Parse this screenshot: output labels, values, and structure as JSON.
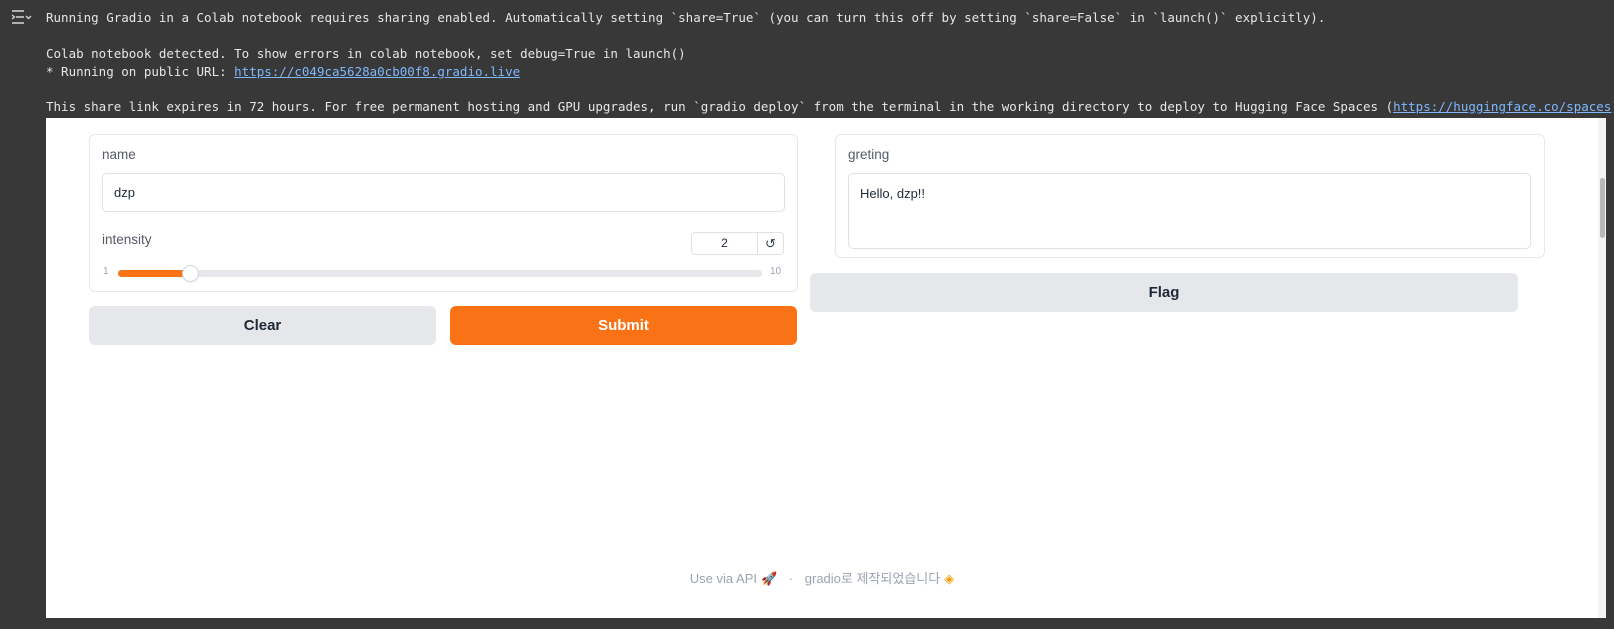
{
  "console": {
    "line1": "Running Gradio in a Colab notebook requires sharing enabled. Automatically setting `share=True` (you can turn this off by setting `share=False` in `launch()` explicitly).",
    "line2": "Colab notebook detected. To show errors in colab notebook, set debug=True in launch()",
    "line3_prefix": "* Running on public URL: ",
    "line3_link": "https://c049ca5628a0cb00f8.gradio.live",
    "line4_prefix": "This share link expires in 72 hours. For free permanent hosting and GPU upgrades, run `gradio deploy` from the terminal in the working directory to deploy to Hugging Face Spaces (",
    "line4_link": "https://huggingface.co/spaces",
    "line4_suffix": ")"
  },
  "inputs": {
    "name_label": "name",
    "name_value": "dzp",
    "intensity_label": "intensity",
    "intensity_value": "2",
    "intensity_min": "1",
    "intensity_max": "10",
    "reset_icon": "↺"
  },
  "output": {
    "label": "greting",
    "value": "Hello, dzp!!"
  },
  "buttons": {
    "clear": "Clear",
    "submit": "Submit",
    "flag": "Flag"
  },
  "footer": {
    "api": "Use via API",
    "separator": "·",
    "made_with": "gradio로 제작되었습니다",
    "rocket_icon": "🚀",
    "logo_icon": "◈"
  },
  "colors": {
    "accent": "#f97316",
    "background": "#383838"
  },
  "icons": {
    "output_toggle": "output-toggle-icon",
    "reset": "reset-icon",
    "rocket": "rocket-icon",
    "gradio_logo": "gradio-logo-icon"
  }
}
